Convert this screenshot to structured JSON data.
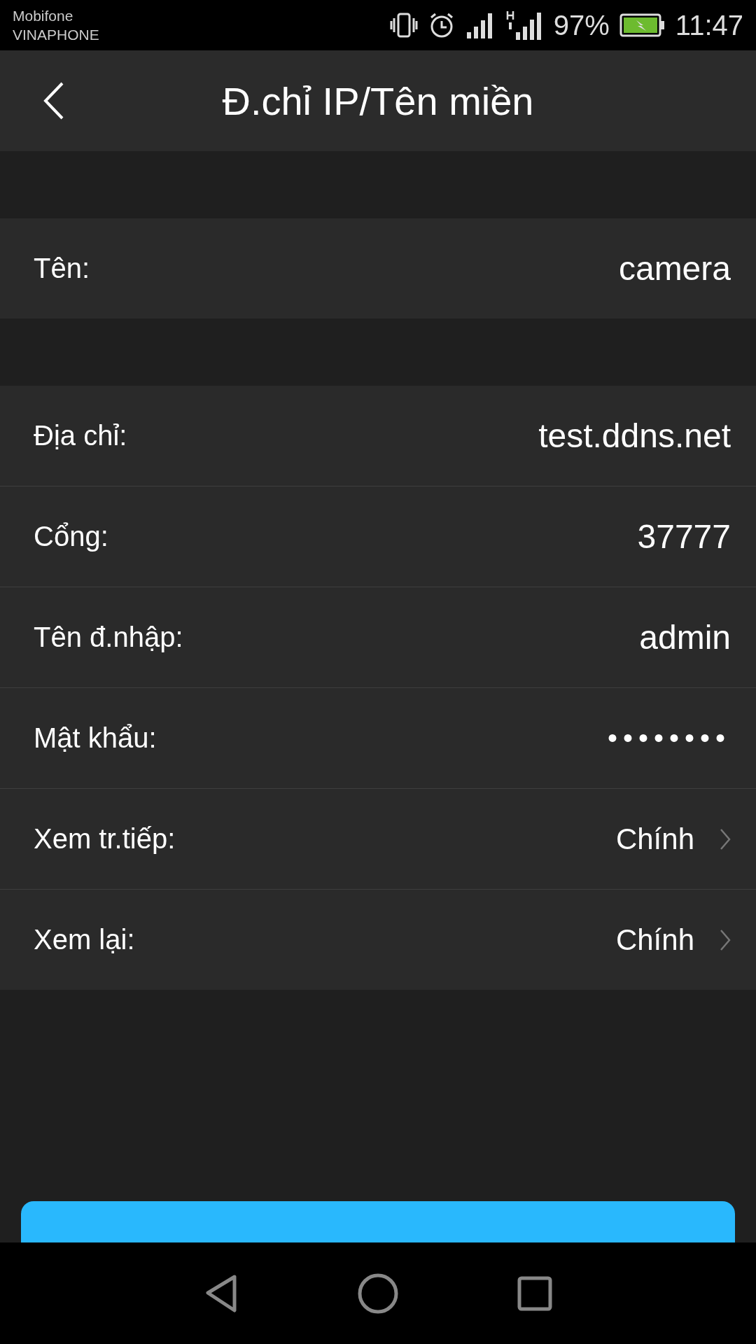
{
  "status_bar": {
    "carriers": [
      "Mobifone",
      "VINAPHONE"
    ],
    "battery_percent": "97%",
    "time": "11:47"
  },
  "header": {
    "title": "Đ.chỉ IP/Tên miền"
  },
  "groups": [
    {
      "rows": [
        {
          "kind": "text",
          "label": "Tên:",
          "value": "camera"
        }
      ]
    },
    {
      "rows": [
        {
          "kind": "text",
          "label": "Địa chỉ:",
          "value": "test.ddns.net"
        },
        {
          "kind": "text",
          "label": "Cổng:",
          "value": "37777"
        },
        {
          "kind": "text",
          "label": "Tên đ.nhập:",
          "value": "admin"
        },
        {
          "kind": "password",
          "label": "Mật khẩu:",
          "value": "••••••••"
        },
        {
          "kind": "select",
          "label": "Xem tr.tiếp:",
          "value": "Chính"
        },
        {
          "kind": "select",
          "label": "Xem lại:",
          "value": "Chính"
        }
      ]
    }
  ],
  "action_button": {
    "kind": "primary"
  }
}
